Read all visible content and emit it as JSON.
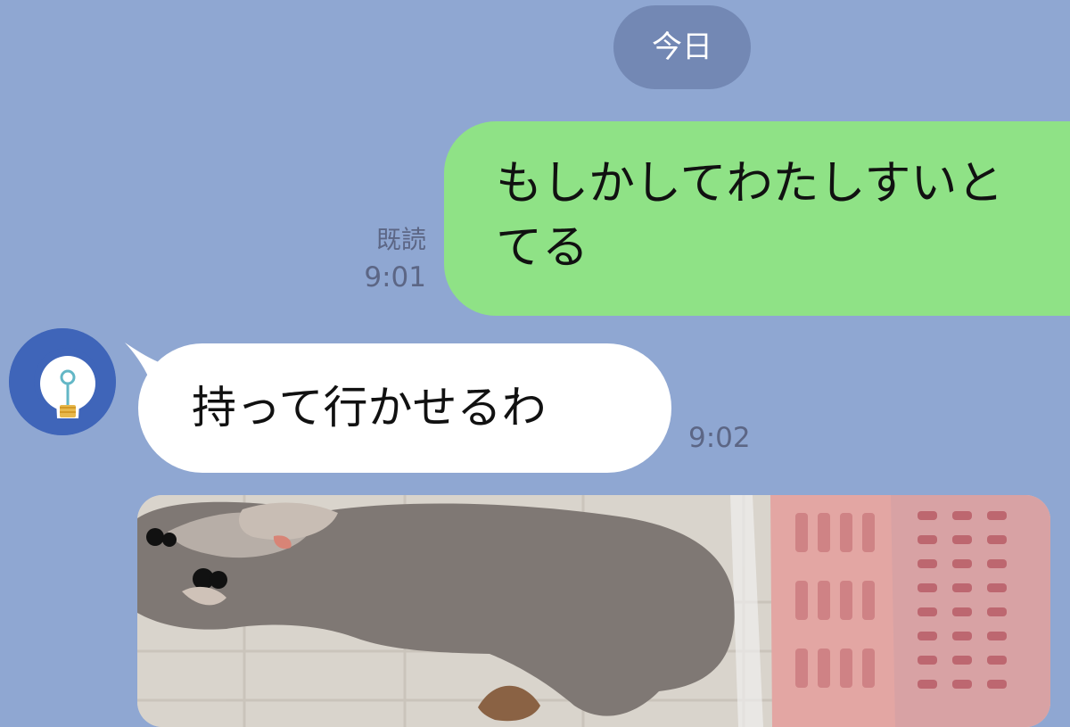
{
  "chat": {
    "date_separator": "今日",
    "sent_message": {
      "lines": [
        "もしかしてわたしすいと",
        "てる"
      ],
      "read_status": "既読",
      "time": "9:01"
    },
    "received_message": {
      "avatar_icon": "lightbulb-icon",
      "text": "持って行かせるわ",
      "time": "9:02"
    },
    "photo_message": {
      "content": "photo-attachment"
    }
  },
  "colors": {
    "background": "#8fa7d2",
    "sent_bubble": "#8fe286",
    "received_bubble": "#ffffff",
    "date_pill": "#7388b4",
    "avatar": "#3f65b9"
  }
}
